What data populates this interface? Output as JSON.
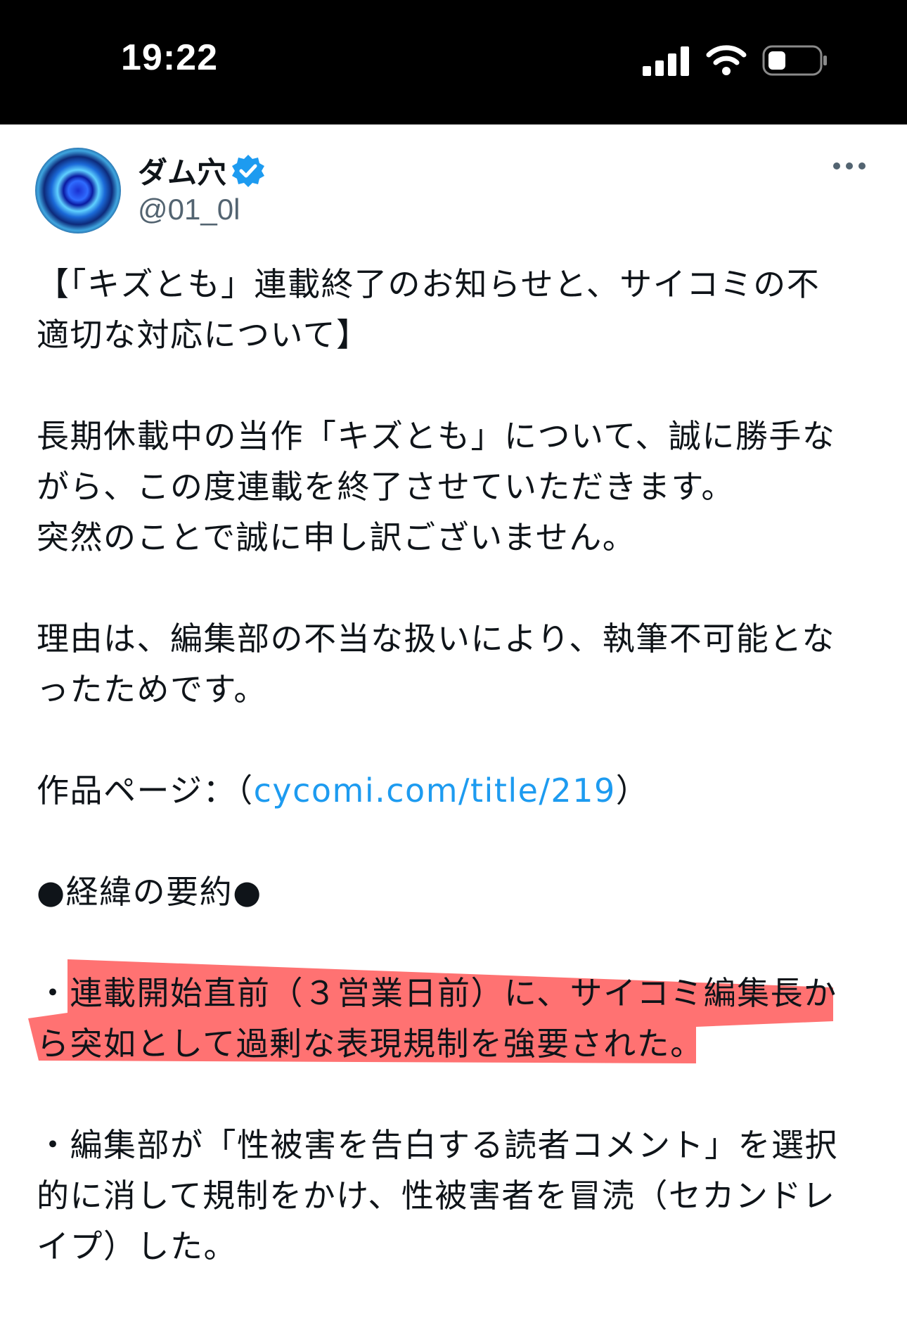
{
  "status_bar": {
    "time": "19:22"
  },
  "author": {
    "display_name": "ダム穴",
    "handle": "@01_0l"
  },
  "post": {
    "title_lines": [
      "【「キズとも」連載終了のお知らせと、サイコミの不",
      "適切な対応について】"
    ],
    "para1_lines": [
      "長期休載中の当作「キズとも」について、誠に勝手な",
      "がら、この度連載を終了させていただきます。",
      "突然のことで誠に申し訳ございません。"
    ],
    "para2_lines": [
      "理由は、編集部の不当な扱いにより、執筆不可能とな",
      "ったためです。"
    ],
    "work_page_prefix": "作品ページ：（",
    "work_page_link": "cycomi.com/title/219",
    "work_page_suffix": "）",
    "summary_heading": "●経緯の要約●",
    "bullet1_lines": [
      "・連載開始直前（３営業日前）に、サイコミ編集長か",
      "ら突如として過剰な表現規制を強要された。"
    ],
    "bullet2_lines": [
      "・編集部が「性被害を告白する読者コメント」を選択",
      "的に消して規制をかけ、性被害者を冒涜（セカンドレ",
      "イプ）した。"
    ]
  },
  "colors": {
    "link": "#1d9bf0",
    "highlight": "#ff3b3b",
    "verified": "#1d9bf0"
  },
  "icons": [
    "signal-icon",
    "wifi-icon",
    "battery-icon",
    "verified-badge-icon",
    "more-options-icon"
  ]
}
